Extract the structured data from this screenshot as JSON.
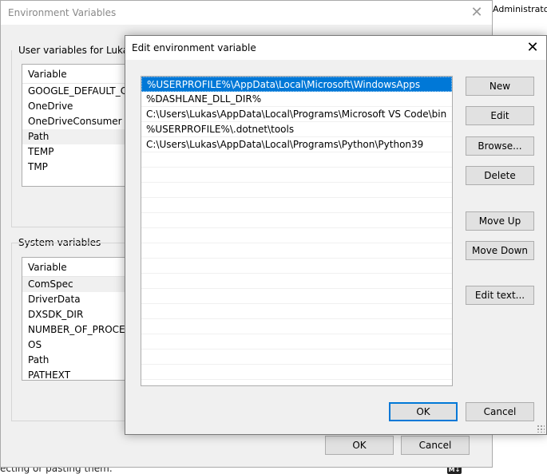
{
  "background": {
    "right_text": "Administrator to",
    "bottom_text": "ecting or pasting them.",
    "md_badge": "M↓"
  },
  "env_window": {
    "title": "Environment Variables",
    "user_group_label": "User variables for Lukas",
    "system_group_label": "System variables",
    "column_variable": "Variable",
    "user_variables": [
      "GOOGLE_DEFAULT_CLIE",
      "OneDrive",
      "OneDriveConsumer",
      "Path",
      "TEMP",
      "TMP"
    ],
    "system_variables": [
      "ComSpec",
      "DriverData",
      "DXSDK_DIR",
      "NUMBER_OF_PROCESS",
      "OS",
      "Path",
      "PATHEXT"
    ],
    "ok_label": "OK",
    "cancel_label": "Cancel"
  },
  "edit_dialog": {
    "title": "Edit environment variable",
    "paths": [
      "%USERPROFILE%\\AppData\\Local\\Microsoft\\WindowsApps",
      "%DASHLANE_DLL_DIR%",
      "C:\\Users\\Lukas\\AppData\\Local\\Programs\\Microsoft VS Code\\bin",
      "%USERPROFILE%\\.dotnet\\tools",
      "C:\\Users\\Lukas\\AppData\\Local\\Programs\\Python\\Python39"
    ],
    "selected_index": 0,
    "buttons": {
      "new": "New",
      "edit": "Edit",
      "browse": "Browse...",
      "delete": "Delete",
      "move_up": "Move Up",
      "move_down": "Move Down",
      "edit_text": "Edit text..."
    },
    "ok_label": "OK",
    "cancel_label": "Cancel"
  },
  "colors": {
    "selection": "#0078d7",
    "dialog_bg": "#f0f0f0",
    "button_bg": "#e1e1e1"
  }
}
